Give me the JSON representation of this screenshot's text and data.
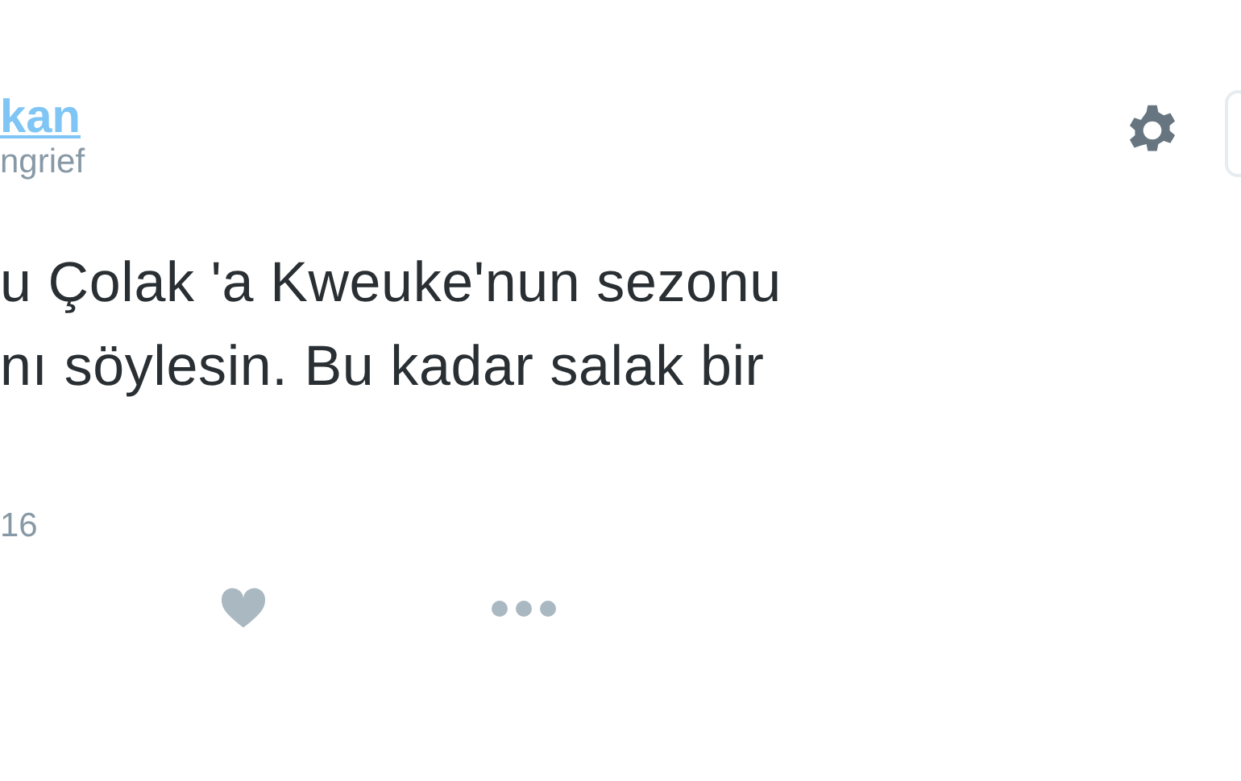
{
  "author": {
    "name": "kan",
    "handle": "ngrief"
  },
  "tweet": {
    "lines": [
      "u Çolak 'a Kweuke'nun sezonu",
      "nı söylesin. Bu kadar salak bir"
    ],
    "date": "16"
  },
  "actions": [
    {
      "kind": "like"
    },
    {
      "kind": "more"
    }
  ]
}
